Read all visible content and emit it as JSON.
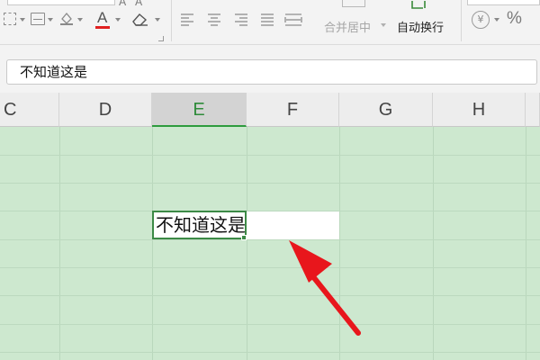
{
  "ribbon": {
    "merge_center_label": "合并居中",
    "auto_wrap_label": "自动换行",
    "font_color_letter": "A",
    "percent_symbol": "%",
    "currency_symbol": "¥"
  },
  "formula_bar": {
    "value": "不知道这是"
  },
  "columns": [
    "C",
    "D",
    "E",
    "F",
    "G",
    "H"
  ],
  "active_column": "E",
  "active_cell": {
    "column": "E",
    "text": "不知道这是"
  },
  "colors": {
    "sheet_background": "#cde8cf",
    "active_accent": "#2e9b3e",
    "font_color_underline": "#e02020",
    "pointer_arrow": "#e8161c"
  },
  "annotation": {
    "shape": "arrow",
    "color": "red"
  }
}
